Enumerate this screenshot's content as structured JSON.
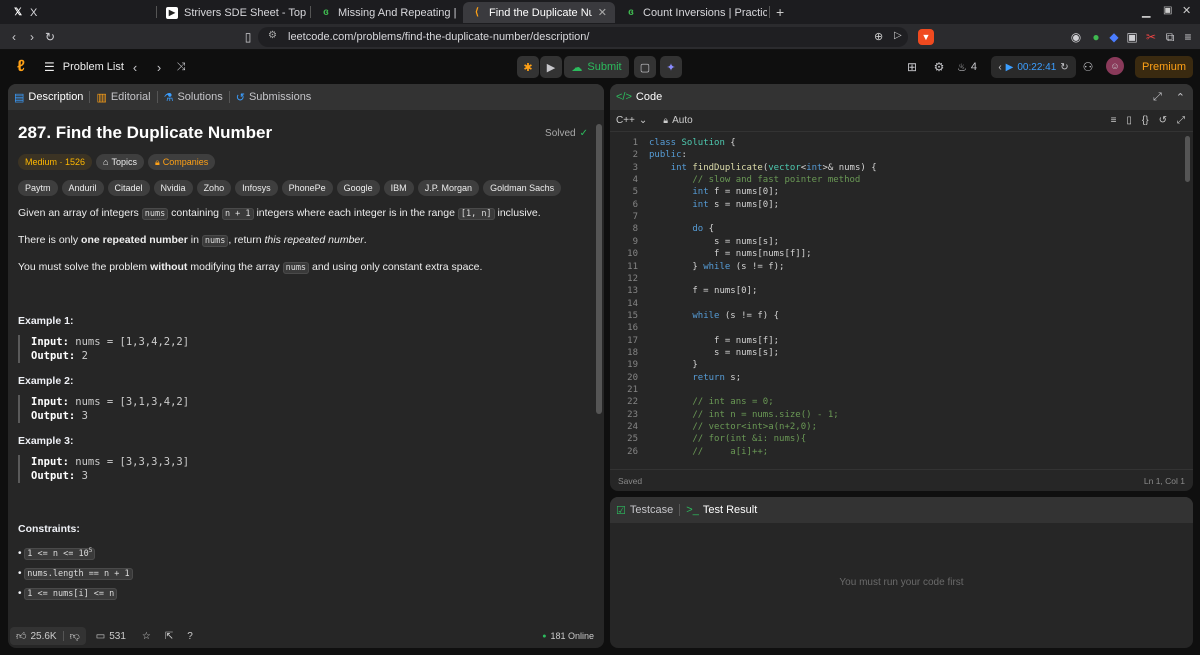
{
  "browser": {
    "tabs": [
      {
        "title": "X",
        "icon": "x-logo-icon"
      },
      {
        "title": "Strivers SDE Sheet - Top Co",
        "icon": "youtube-icon"
      },
      {
        "title": "Missing And Repeating | Pr",
        "icon": "gfg-icon"
      },
      {
        "title": "Find the Duplicate Numb",
        "icon": "leetcode-icon"
      },
      {
        "title": "Count Inversions | Practice",
        "icon": "gfg-icon"
      }
    ],
    "url": "leetcode.com/problems/find-the-duplicate-number/description/"
  },
  "nav": {
    "problem_list": "Problem List",
    "submit": "Submit",
    "streak": "4",
    "timer": "00:22:41",
    "premium": "Premium"
  },
  "desc_panel": {
    "tabs": [
      "Description",
      "Editorial",
      "Solutions",
      "Submissions"
    ],
    "title": "287. Find the Duplicate Number",
    "solved": "Solved",
    "difficulty": "Medium · 1526",
    "topics": "Topics",
    "companies_label": "Companies",
    "companies": [
      "Paytm",
      "Anduril",
      "Citadel",
      "Nvidia",
      "Zoho",
      "Infosys",
      "PhonePe",
      "Google",
      "IBM",
      "J.P. Morgan",
      "Goldman Sachs"
    ],
    "p1": {
      "a": "Given an array of integers",
      "code1": "nums",
      "b": "containing",
      "code2": "n + 1",
      "c": "integers where each integer is in the range",
      "code3": "[1, n]",
      "d": "inclusive."
    },
    "p2": {
      "a": "There is only",
      "bold": "one repeated number",
      "b": "in",
      "code": "nums",
      "c": ", return",
      "italic": "this repeated number",
      "d": "."
    },
    "p3": {
      "a": "You must solve the problem",
      "bold": "without",
      "b": "modifying the array",
      "code": "nums",
      "c": "and using only constant extra space."
    },
    "examples": [
      {
        "heading": "Example 1:",
        "input": "nums = [1,3,4,2,2]",
        "output": "2"
      },
      {
        "heading": "Example 2:",
        "input": "nums = [3,1,3,4,2]",
        "output": "3"
      },
      {
        "heading": "Example 3:",
        "input": "nums = [3,3,3,3,3]",
        "output": "3"
      }
    ],
    "input_label": "Input:",
    "output_label": "Output:",
    "constraints_heading": "Constraints:",
    "constraints": [
      {
        "text": "1 <= n <= 10",
        "sup": "5"
      },
      {
        "text": "nums.length == n + 1",
        "sup": ""
      },
      {
        "text": "1 <= nums[i] <= n",
        "sup": ""
      }
    ],
    "likes": "25.6K",
    "comments": "531",
    "online": "181 Online"
  },
  "code_panel": {
    "title": "Code",
    "language": "C++",
    "auto": "Auto",
    "saved": "Saved",
    "cursor": "Ln 1, Col 1",
    "lines": [
      "class Solution {",
      "public:",
      "    int findDuplicate(vector<int>& nums) {",
      "        // slow and fast pointer method",
      "        int f = nums[0];",
      "        int s = nums[0];",
      "",
      "        do {",
      "            s = nums[s];",
      "            f = nums[nums[f]];",
      "        } while (s != f);",
      "",
      "        f = nums[0];",
      "",
      "        while (s != f) {",
      "",
      "            f = nums[f];",
      "            s = nums[s];",
      "        }",
      "        return s;",
      "",
      "        // int ans = 0;",
      "        // int n = nums.size() - 1;",
      "        // vector<int>a(n+2,0);",
      "        // for(int &i: nums){",
      "        //     a[i]++;"
    ]
  },
  "test_panel": {
    "testcase": "Testcase",
    "result": "Test Result",
    "message": "You must run your code first"
  },
  "colors": {
    "accent_orange": "#ffa116",
    "green": "#2cbb5d",
    "medium": "#ffb800"
  }
}
